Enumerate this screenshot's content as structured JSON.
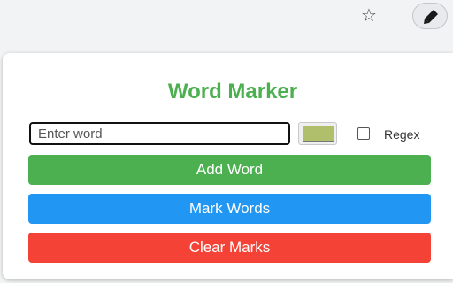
{
  "browser": {
    "bookmark_icon": "star-outline-icon",
    "extension_icon": "marker-pen-icon"
  },
  "popup": {
    "title": "Word Marker",
    "word_input": {
      "placeholder": "Enter word",
      "value": ""
    },
    "color": {
      "selected": "#b0bf6c"
    },
    "regex": {
      "label": "Regex",
      "checked": false
    },
    "buttons": {
      "add": "Add Word",
      "mark": "Mark Words",
      "clear": "Clear Marks"
    }
  },
  "colors": {
    "title": "#4caf50",
    "add": "#4caf50",
    "mark": "#2196f3",
    "clear": "#f44336"
  }
}
